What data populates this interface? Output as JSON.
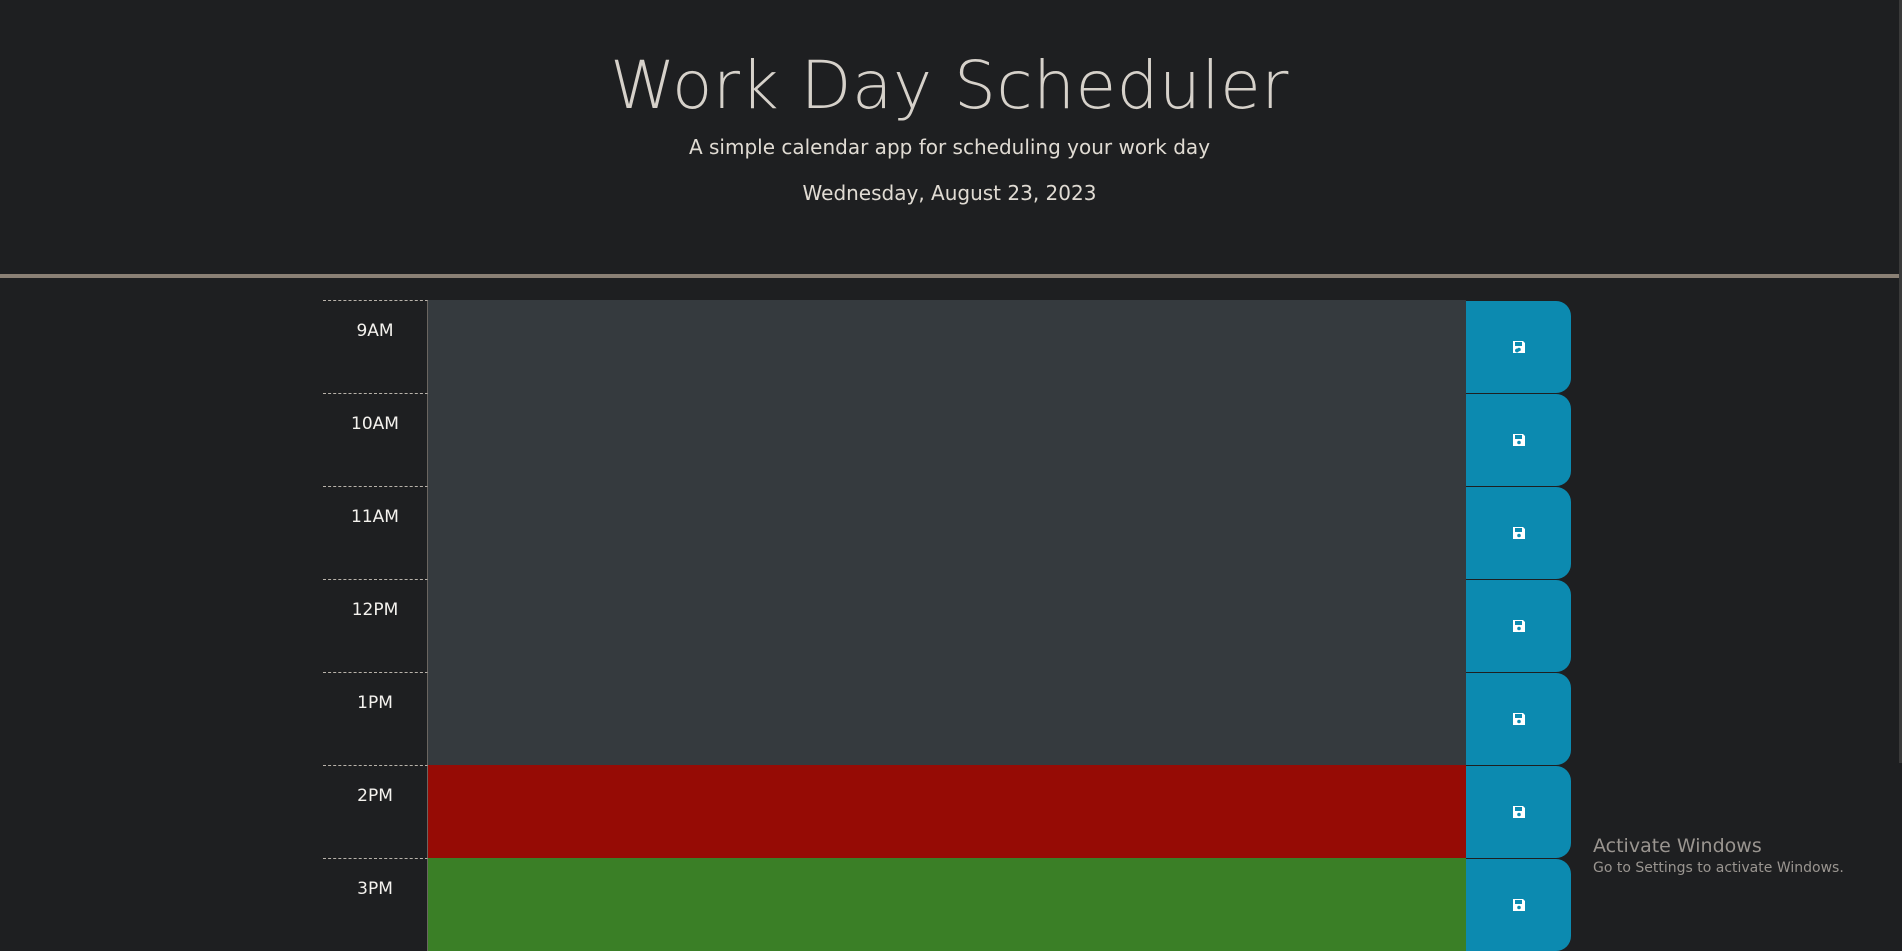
{
  "header": {
    "title": "Work Day Scheduler",
    "subtitle": "A simple calendar app for scheduling your work day",
    "current_date": "Wednesday, August 23, 2023"
  },
  "timeblocks": [
    {
      "hour": "9AM",
      "text": "",
      "state": "past"
    },
    {
      "hour": "10AM",
      "text": "",
      "state": "past"
    },
    {
      "hour": "11AM",
      "text": "",
      "state": "past"
    },
    {
      "hour": "12PM",
      "text": "",
      "state": "past"
    },
    {
      "hour": "1PM",
      "text": "",
      "state": "past"
    },
    {
      "hour": "2PM",
      "text": "",
      "state": "present"
    },
    {
      "hour": "3PM",
      "text": "",
      "state": "future"
    }
  ],
  "icons": {
    "save": "save-icon"
  },
  "colors": {
    "background": "#1e1f21",
    "past": "#353a3e",
    "present": "#960b05",
    "future": "#3a7f26",
    "save_button": "#0c8ab0",
    "header_border": "#8a8075"
  },
  "watermark": {
    "title": "Activate Windows",
    "subtitle": "Go to Settings to activate Windows."
  }
}
